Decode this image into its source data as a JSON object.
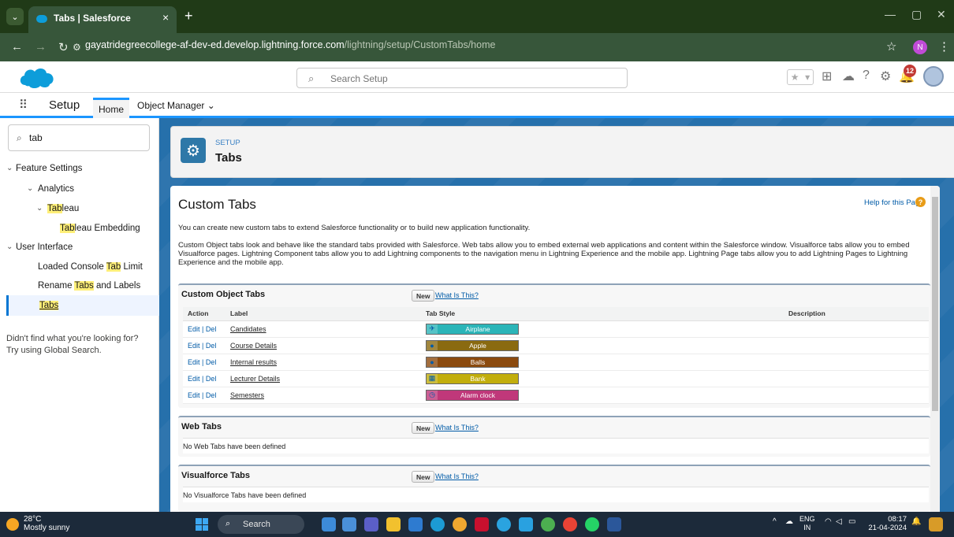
{
  "browser": {
    "tab_title": "Tabs | Salesforce",
    "tab_close": "×",
    "new_tab": "+",
    "url_host": "gayatridegreecollege-af-dev-ed.develop.lightning.force.com",
    "url_path": "/lightning/setup/CustomTabs/home",
    "profile_initial": "N"
  },
  "header": {
    "search_placeholder": "Search Setup",
    "notification_count": "12"
  },
  "nav": {
    "app_name": "Setup",
    "tabs": [
      {
        "label": "Home"
      },
      {
        "label": "Object Manager"
      }
    ]
  },
  "sidebar": {
    "quick_find_value": "tab",
    "items": [
      {
        "label": "Feature Settings"
      },
      {
        "label": "Analytics"
      },
      {
        "pre": "",
        "hl": "Tab",
        "post": "leau"
      },
      {
        "pre": "",
        "hl": "Tab",
        "post": "leau Embedding"
      },
      {
        "label": "User Interface"
      },
      {
        "pre": "Loaded Console ",
        "hl": "Tab",
        "post": " Limit"
      },
      {
        "pre": "Rename ",
        "hl": "Tabs",
        "post": " and Labels"
      },
      {
        "pre": "",
        "hl": "Tabs",
        "post": ""
      }
    ],
    "help_text": "Didn't find what you're looking for? Try using Global Search."
  },
  "page_header": {
    "overline": "SETUP",
    "title": "Tabs"
  },
  "content": {
    "title": "Custom Tabs",
    "help_link": "Help for this Page",
    "intro": "You can create new custom tabs to extend Salesforce functionality or to build new application functionality.",
    "description": "Custom Object tabs look and behave like the standard tabs provided with Salesforce. Web tabs allow you to embed external web applications and content within the Salesforce window. Visualforce tabs allow you to embed Visualforce pages. Lightning Component tabs allow you to add Lightning components to the navigation menu in Lightning Experience and the mobile app. Lightning Page tabs allow you to add Lightning Pages to Lightning Experience and the mobile app.",
    "new_label": "New",
    "what_label": "What Is This?",
    "custom_object_tabs": {
      "title": "Custom Object Tabs",
      "columns": [
        "Action",
        "Label",
        "Tab Style",
        "Description"
      ],
      "edit": "Edit",
      "sep": " | ",
      "del": "Del",
      "rows": [
        {
          "label": "Candidates",
          "style": "Airplane",
          "color": "#2bb5b8",
          "icon": "✈"
        },
        {
          "label": "Course Details",
          "style": "Apple",
          "color": "#8a6a10",
          "icon": "●"
        },
        {
          "label": "Internal results",
          "style": "Balls",
          "color": "#8b4a0e",
          "icon": "●"
        },
        {
          "label": "Lecturer Details",
          "style": "Bank",
          "color": "#c2ae0c",
          "icon": "▦"
        },
        {
          "label": "Semesters",
          "style": "Alarm clock",
          "color": "#c0387a",
          "icon": "◷"
        }
      ]
    },
    "web_tabs": {
      "title": "Web Tabs",
      "empty": "No Web Tabs have been defined"
    },
    "visualforce_tabs": {
      "title": "Visualforce Tabs",
      "empty": "No Visualforce Tabs have been defined"
    }
  },
  "taskbar": {
    "temperature": "28°C",
    "weather": "Mostly sunny",
    "search": "Search",
    "lang1": "ENG",
    "lang2": "IN",
    "time": "08:17",
    "date": "21-04-2024"
  }
}
